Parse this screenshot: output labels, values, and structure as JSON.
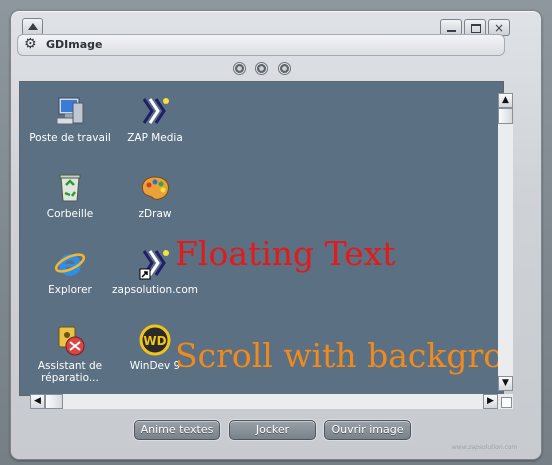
{
  "window": {
    "title": "GDImage",
    "controls": {
      "menu_icon": "up-triangle-icon",
      "minimize_icon": "minimize-icon",
      "maximize_icon": "maximize-icon",
      "close_icon": "close-icon",
      "close_glyph": "×"
    }
  },
  "titlebar": {
    "icon": "gear-icon",
    "title": "GDImage"
  },
  "indicator_dots": 3,
  "desktop_icons": [
    {
      "label": "Poste de travail",
      "icon": "computer-icon"
    },
    {
      "label": "ZAP Media",
      "icon": "zap-media-icon"
    },
    {
      "label": "Corbeille",
      "icon": "recycle-bin-icon"
    },
    {
      "label": "zDraw",
      "icon": "palette-icon"
    },
    {
      "label": "Explorer",
      "icon": "internet-explorer-icon"
    },
    {
      "label": "zapsolution.com",
      "icon": "zap-shortcut-icon"
    },
    {
      "label": "Assistant de réparatio...",
      "icon": "repair-assistant-icon"
    },
    {
      "label": "WinDev 9",
      "icon": "windev-icon"
    }
  ],
  "overlay_texts": {
    "floating": "Floating Text",
    "scrolling": "Scroll with backgro"
  },
  "buttons": {
    "animate": "Anime textes",
    "joker": "Jocker",
    "open_image": "Ouvrir image"
  },
  "colors": {
    "desktop_bg": "#5b7083",
    "floating_text": "#e21a1a",
    "scroll_text": "#f08a1c"
  },
  "watermark": "www.zapsolution.com"
}
